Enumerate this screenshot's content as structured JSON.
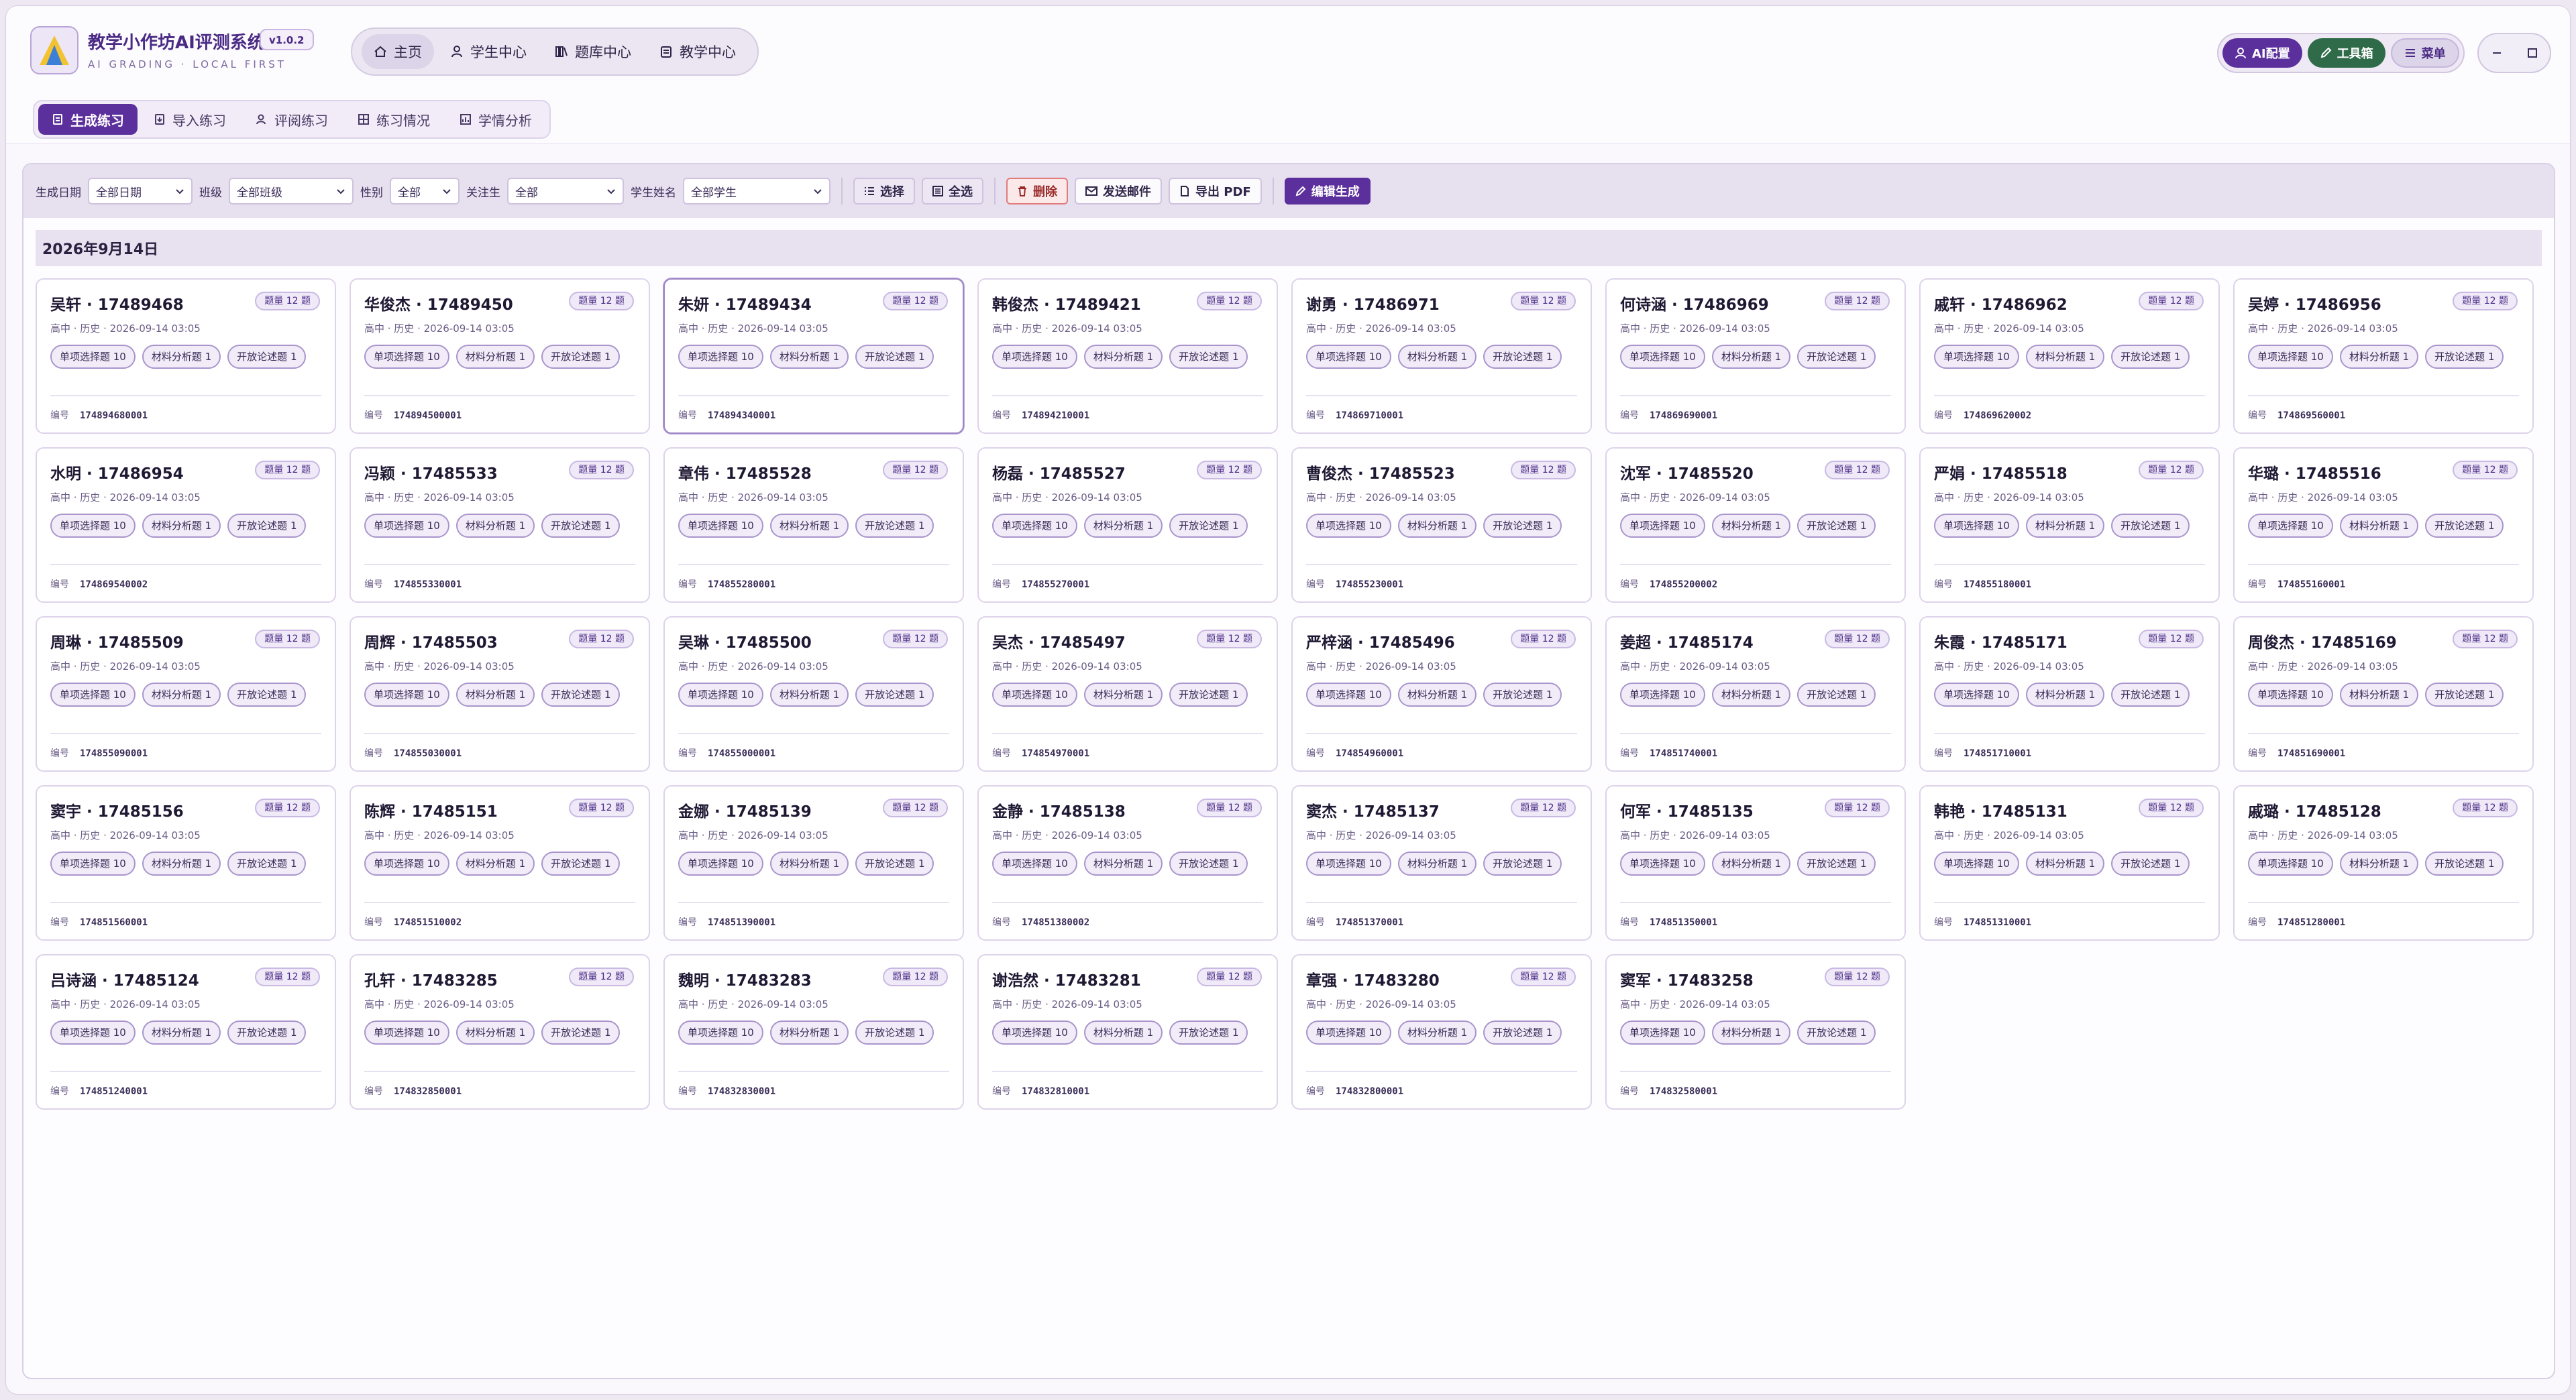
{
  "app": {
    "title": "教学小作坊AI评测系统",
    "version": "v1.0.2",
    "subtitle": "AI GRADING · LOCAL FIRST"
  },
  "topnav": [
    {
      "label": "主页",
      "icon": "home-icon"
    },
    {
      "label": "学生中心",
      "icon": "user-icon"
    },
    {
      "label": "题库中心",
      "icon": "books-icon"
    },
    {
      "label": "教学中心",
      "icon": "clipboard-icon"
    }
  ],
  "right_tools": {
    "ai_config": "AI配置",
    "toolbox": "工具箱",
    "menu": "菜单"
  },
  "subnav": [
    {
      "label": "生成练习",
      "icon": "document-icon",
      "active": true
    },
    {
      "label": "导入练习",
      "icon": "import-icon",
      "active": false
    },
    {
      "label": "评阅练习",
      "icon": "user-check-icon",
      "active": false
    },
    {
      "label": "练习情况",
      "icon": "grid-icon",
      "active": false
    },
    {
      "label": "学情分析",
      "icon": "chart-icon",
      "active": false
    }
  ],
  "filters": {
    "date_label": "生成日期",
    "date_value": "全部日期",
    "class_label": "班级",
    "class_value": "全部班级",
    "gender_label": "性别",
    "gender_value": "全部",
    "focus_label": "关注生",
    "focus_value": "全部",
    "name_label": "学生姓名",
    "name_value": "全部学生"
  },
  "actions": {
    "select": "选择",
    "select_all": "全选",
    "delete": "删除",
    "send_mail": "发送邮件",
    "export_pdf": "导出 PDF",
    "edit_generate": "编辑生成"
  },
  "group_date": "2026年9月14日",
  "card_labels": {
    "meta": "高中 · 历史 · 2026-09-14 03:05",
    "badge": "题量 12 题",
    "code_label": "编号",
    "tags": [
      "单项选择题 10",
      "材料分析题 1",
      "开放论述题 1"
    ]
  },
  "cards": [
    {
      "name": "吴轩 · 17489468",
      "code": "174894680001"
    },
    {
      "name": "华俊杰 · 17489450",
      "code": "174894500001"
    },
    {
      "name": "朱妍 · 17489434",
      "code": "174894340001"
    },
    {
      "name": "韩俊杰 · 17489421",
      "code": "174894210001"
    },
    {
      "name": "谢勇 · 17486971",
      "code": "174869710001"
    },
    {
      "name": "何诗涵 · 17486969",
      "code": "174869690001"
    },
    {
      "name": "戚轩 · 17486962",
      "code": "174869620002"
    },
    {
      "name": "吴婷 · 17486956",
      "code": "174869560001"
    },
    {
      "name": "水明 · 17486954",
      "code": "174869540002"
    },
    {
      "name": "冯颖 · 17485533",
      "code": "174855330001"
    },
    {
      "name": "章伟 · 17485528",
      "code": "174855280001"
    },
    {
      "name": "杨磊 · 17485527",
      "code": "174855270001"
    },
    {
      "name": "曹俊杰 · 17485523",
      "code": "174855230001"
    },
    {
      "name": "沈军 · 17485520",
      "code": "174855200002"
    },
    {
      "name": "严娟 · 17485518",
      "code": "174855180001"
    },
    {
      "name": "华璐 · 17485516",
      "code": "174855160001"
    },
    {
      "name": "周琳 · 17485509",
      "code": "174855090001"
    },
    {
      "name": "周辉 · 17485503",
      "code": "174855030001"
    },
    {
      "name": "吴琳 · 17485500",
      "code": "174855000001"
    },
    {
      "name": "吴杰 · 17485497",
      "code": "174854970001"
    },
    {
      "name": "严梓涵 · 17485496",
      "code": "174854960001"
    },
    {
      "name": "姜超 · 17485174",
      "code": "174851740001"
    },
    {
      "name": "朱霞 · 17485171",
      "code": "174851710001"
    },
    {
      "name": "周俊杰 · 17485169",
      "code": "174851690001"
    },
    {
      "name": "窦宇 · 17485156",
      "code": "174851560001"
    },
    {
      "name": "陈辉 · 17485151",
      "code": "174851510002"
    },
    {
      "name": "金娜 · 17485139",
      "code": "174851390001"
    },
    {
      "name": "金静 · 17485138",
      "code": "174851380002"
    },
    {
      "name": "窦杰 · 17485137",
      "code": "174851370001"
    },
    {
      "name": "何军 · 17485135",
      "code": "174851350001"
    },
    {
      "name": "韩艳 · 17485131",
      "code": "174851310001"
    },
    {
      "name": "戚璐 · 17485128",
      "code": "174851280001"
    },
    {
      "name": "吕诗涵 · 17485124",
      "code": "174851240001"
    },
    {
      "name": "孔轩 · 17483285",
      "code": "174832850001"
    },
    {
      "name": "魏明 · 17483283",
      "code": "174832830001"
    },
    {
      "name": "谢浩然 · 17483281",
      "code": "174832810001"
    },
    {
      "name": "章强 · 17483280",
      "code": "174832800001"
    },
    {
      "name": "窦军 · 17483258",
      "code": "174832580001"
    }
  ],
  "colors": {
    "accent": "#5b2f9c",
    "green": "#2f6b49",
    "background": "#ede8f2"
  }
}
